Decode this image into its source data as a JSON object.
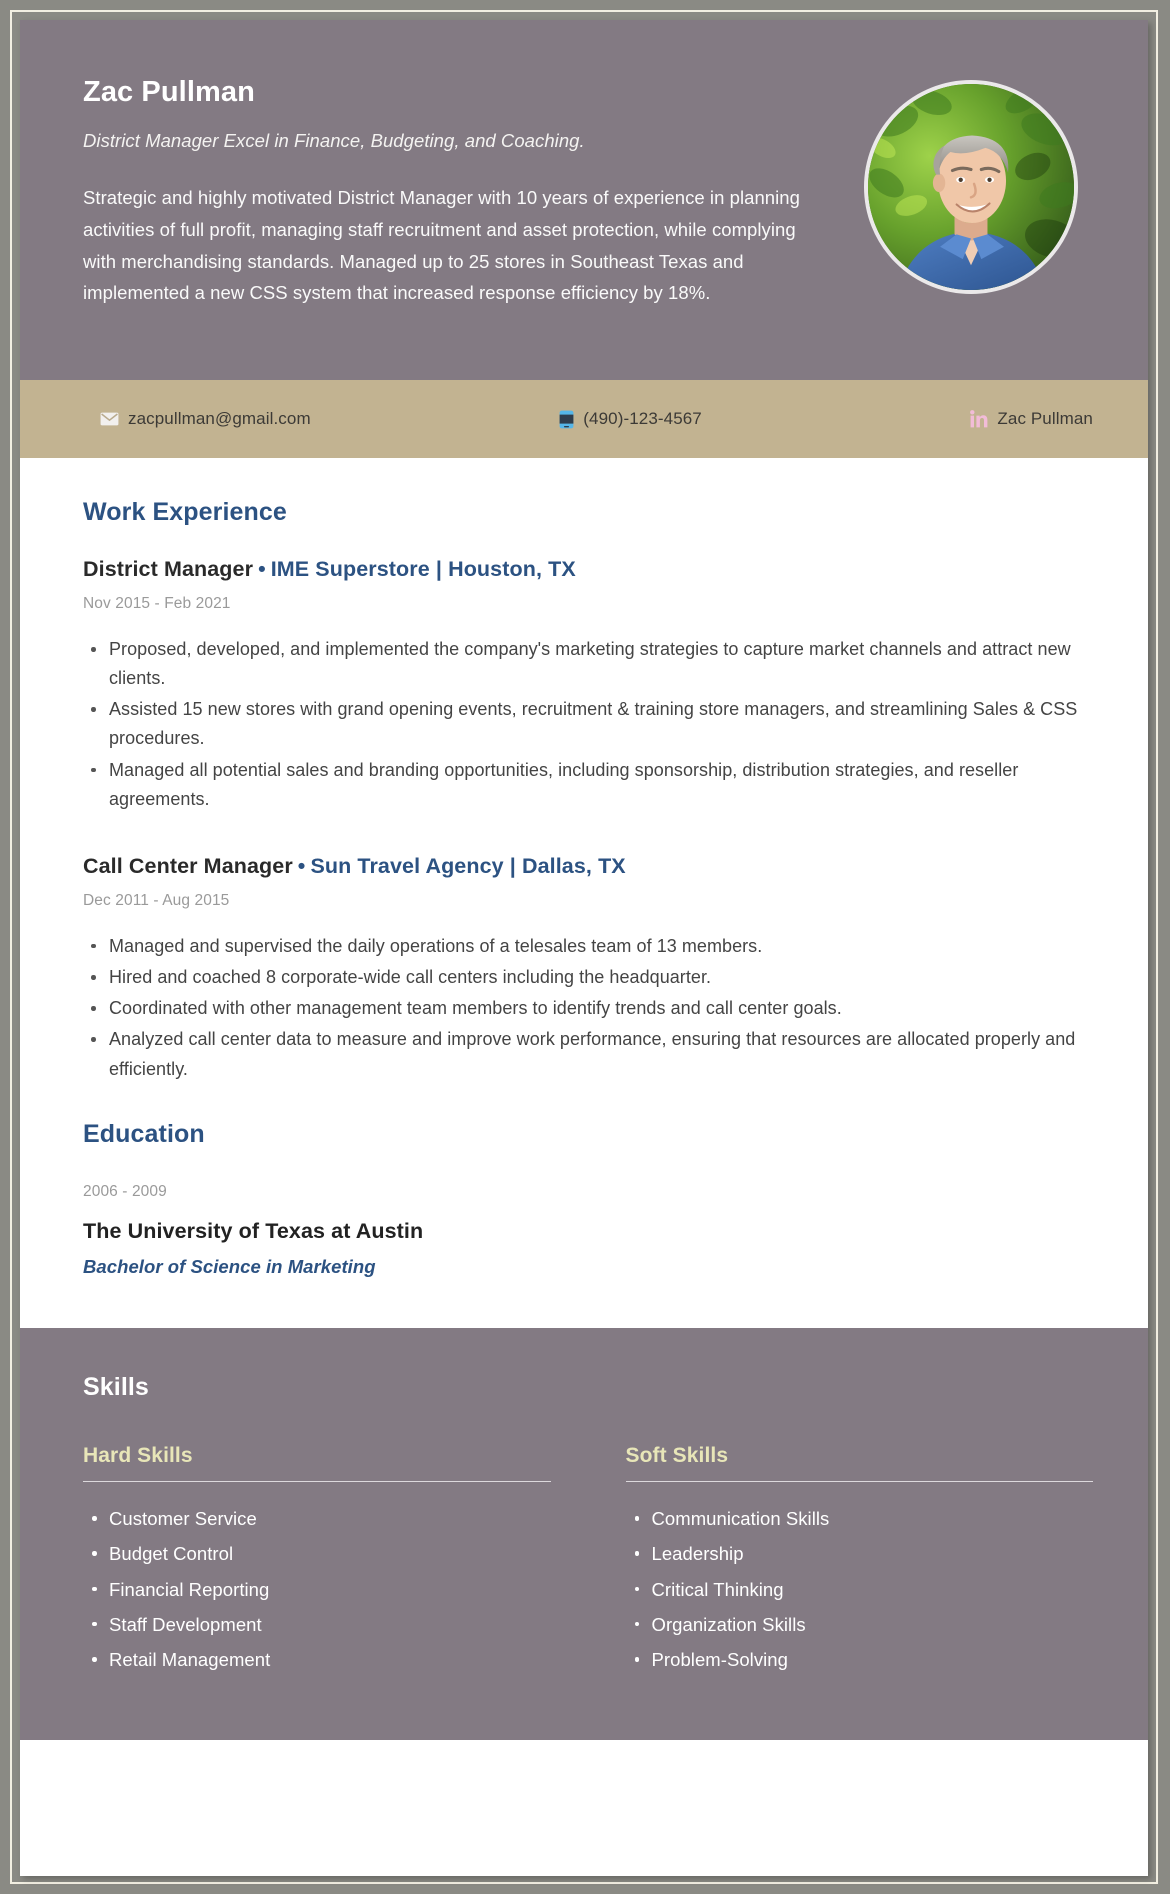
{
  "colors": {
    "header_bg": "#837a83",
    "contact_bg": "#c2b391",
    "accent_blue": "#2c5282",
    "skills_heading": "#e8e6b8",
    "page_bg": "#8a8a84",
    "linkedin_icon": "#f2bcd8"
  },
  "header": {
    "full_name": "Zac Pullman",
    "headline": "District Manager Excel in Finance, Budgeting, and Coaching.",
    "summary": "Strategic and highly motivated District Manager with 10 years of experience in planning activities of full profit, managing staff recruitment and asset protection, while complying with merchandising standards. Managed up to 25 stores in Southeast Texas and implemented a new CSS system that increased response efficiency by 18%.",
    "photo_alt": "Portrait of smiling man in blue shirt with green foliage background"
  },
  "contact": {
    "email": {
      "icon": "envelope-icon",
      "value": "zacpullman@gmail.com"
    },
    "phone": {
      "icon": "smartphone-icon",
      "value": "(490)-123-4567"
    },
    "linkedin": {
      "icon": "linkedin-icon",
      "value": "Zac Pullman"
    }
  },
  "work_experience": {
    "title": "Work Experience",
    "jobs": [
      {
        "role": "District Manager",
        "separator": "•",
        "company": "IME Superstore | Houston, TX",
        "dates": "Nov 2015 - Feb 2021",
        "bullets": [
          "Proposed, developed, and implemented the company's marketing strategies to capture market channels and attract new clients.",
          "Assisted 15 new stores with grand opening events, recruitment & training store managers, and streamlining Sales & CSS procedures.",
          "Managed all potential sales and branding opportunities, including sponsorship, distribution strategies, and reseller agreements."
        ]
      },
      {
        "role": "Call Center Manager",
        "separator": "•",
        "company": "Sun Travel Agency | Dallas, TX",
        "dates": "Dec 2011 - Aug 2015",
        "bullets": [
          "Managed and supervised the daily operations of a telesales team of 13 members.",
          "Hired and coached 8 corporate-wide call centers including the headquarter.",
          "Coordinated with other management team members to identify trends and call center goals.",
          "Analyzed call center data to measure and improve work performance, ensuring that resources are allocated properly and efficiently."
        ]
      }
    ]
  },
  "education": {
    "title": "Education",
    "dates": "2006 - 2009",
    "school": "The University of Texas at Austin",
    "degree": "Bachelor of Science in Marketing"
  },
  "skills": {
    "title": "Skills",
    "columns": [
      {
        "heading": "Hard Skills",
        "items": [
          "Customer Service",
          "Budget Control",
          "Financial Reporting",
          "Staff Development",
          "Retail Management"
        ]
      },
      {
        "heading": "Soft Skills",
        "items": [
          "Communication Skills",
          "Leadership",
          "Critical Thinking",
          "Organization Skills",
          "Problem-Solving"
        ]
      }
    ]
  }
}
